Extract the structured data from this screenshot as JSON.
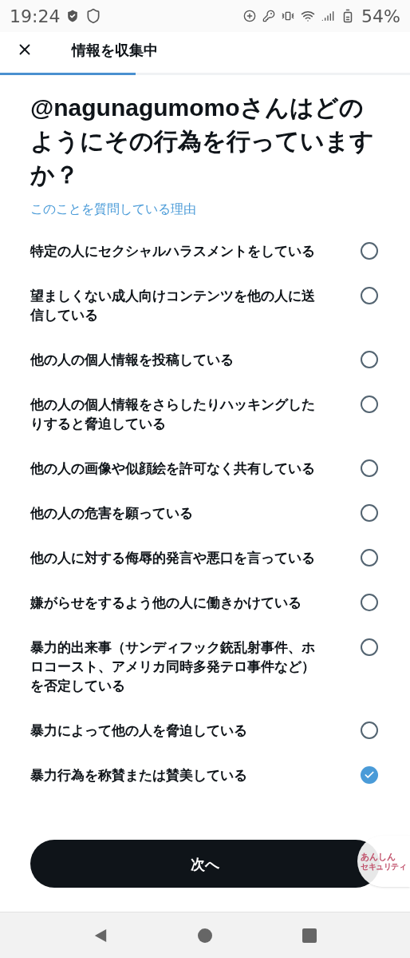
{
  "status_bar": {
    "time": "19:24",
    "battery": "54%"
  },
  "header": {
    "title": "情報を収集中",
    "progress": {
      "level": 0.33
    }
  },
  "question": "@nagunagumomoさんはどのようにその行為を行っていますか？",
  "why_link": "このことを質問している理由",
  "options": [
    {
      "label": "特定の人にセクシャルハラスメントをしている",
      "selected": false
    },
    {
      "label": "望ましくない成人向けコンテンツを他の人に送信している",
      "selected": false
    },
    {
      "label": "他の人の個人情報を投稿している",
      "selected": false
    },
    {
      "label": "他の人の個人情報をさらしたりハッキングしたりすると脅迫している",
      "selected": false
    },
    {
      "label": "他の人の画像や似顔絵を許可なく共有している",
      "selected": false
    },
    {
      "label": "他の人の危害を願っている",
      "selected": false
    },
    {
      "label": "他の人に対する侮辱的発言や悪口を言っている",
      "selected": false
    },
    {
      "label": "嫌がらせをするよう他の人に働きかけている",
      "selected": false
    },
    {
      "label": "暴力的出来事（サンディフック銃乱射事件、ホロコースト、アメリカ同時多発テロ事件など）を否定している",
      "selected": false
    },
    {
      "label": "暴力によって他の人を脅迫している",
      "selected": false
    },
    {
      "label": "暴力行為を称賛または賛美している",
      "selected": true
    }
  ],
  "next_button": "次へ",
  "floating_badge": {
    "line_1": "あんしん",
    "line_2": "セキュリティ"
  }
}
